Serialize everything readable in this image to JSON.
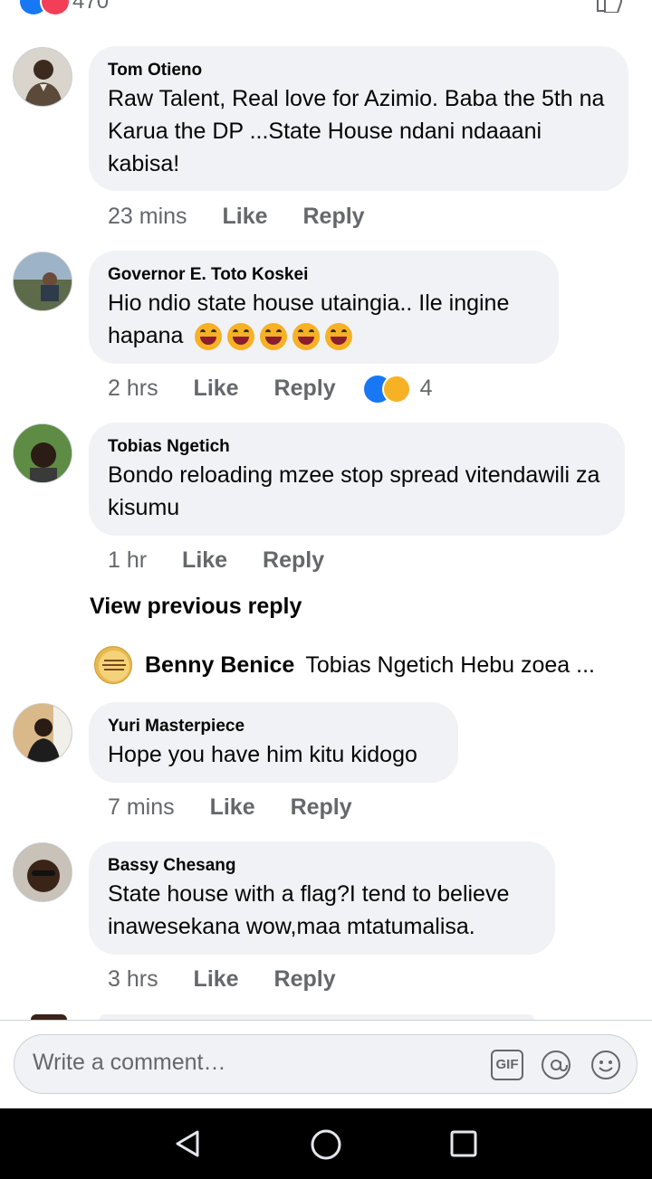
{
  "top": {
    "reaction_count": "470"
  },
  "comments": [
    {
      "author": "Tom Otieno",
      "text": "Raw Talent, Real love for  Azimio. Baba the 5th na Karua the DP ...State House ndani ndaaani kabisa!",
      "time": "23 mins",
      "like": "Like",
      "reply": "Reply"
    },
    {
      "author": "Governor E. Toto Koskei",
      "text": "Hio ndio state house utaingia.. Ile ingine hapana",
      "time": "2 hrs",
      "like": "Like",
      "reply": "Reply",
      "reactions_count": "4"
    },
    {
      "author": "Tobias Ngetich",
      "text": "Bondo reloading mzee stop spread vitendawili za kisumu",
      "time": "1 hr",
      "like": "Like",
      "reply": "Reply"
    },
    {
      "author": "Yuri Masterpiece",
      "text": "Hope you have him kitu kidogo",
      "time": "7 mins",
      "like": "Like",
      "reply": "Reply"
    },
    {
      "author": "Bassy Chesang",
      "text": "State house with a flag?I tend to believe inawesekana wow,maa mtatumalisa.",
      "time": "3 hrs",
      "like": "Like",
      "reply": "Reply"
    }
  ],
  "view_previous": "View previous reply",
  "reply_preview": {
    "author": "Benny Benice",
    "text": "Tobias Ngetich Hebu zoea ..."
  },
  "composer": {
    "placeholder": "Write a comment…",
    "gif_label": "GIF"
  },
  "colors": {
    "accent": "#1877f2",
    "bubble": "#f0f2f5",
    "secondary_text": "#65676b"
  }
}
